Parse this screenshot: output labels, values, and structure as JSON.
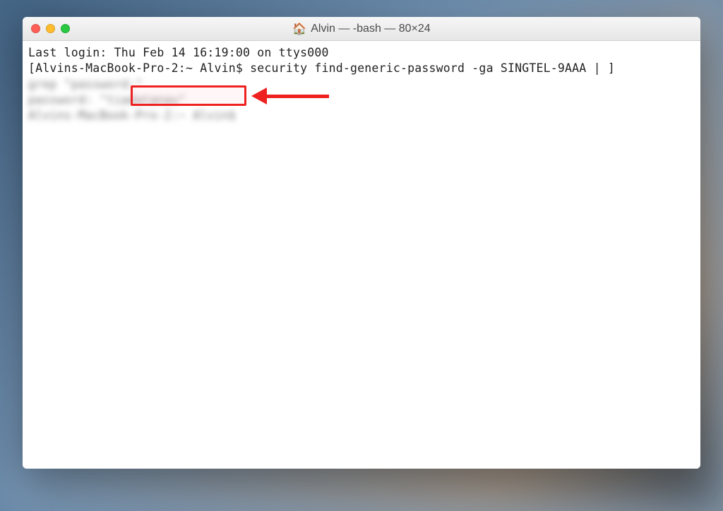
{
  "window": {
    "title": "Alvin — -bash — 80×24",
    "traffic": {
      "close": "close",
      "minimize": "minimize",
      "zoom": "zoom"
    },
    "home_icon": "🏠"
  },
  "terminal": {
    "lines": [
      "Last login: Thu Feb 14 16:19:00 on ttys000",
      "[Alvins-MacBook-Pro-2:~ Alvin$ security find-generic-password -ga SINGTEL-9AAA | ]"
    ],
    "blurred_lines": [
      "grep \"password:\"",
      "password: \"tiadatanau\"",
      "Alvins-MacBook-Pro-2:~ Alvin$ "
    ]
  },
  "annotation": {
    "highlight_target": "password-value",
    "arrow": "pointing-left"
  }
}
